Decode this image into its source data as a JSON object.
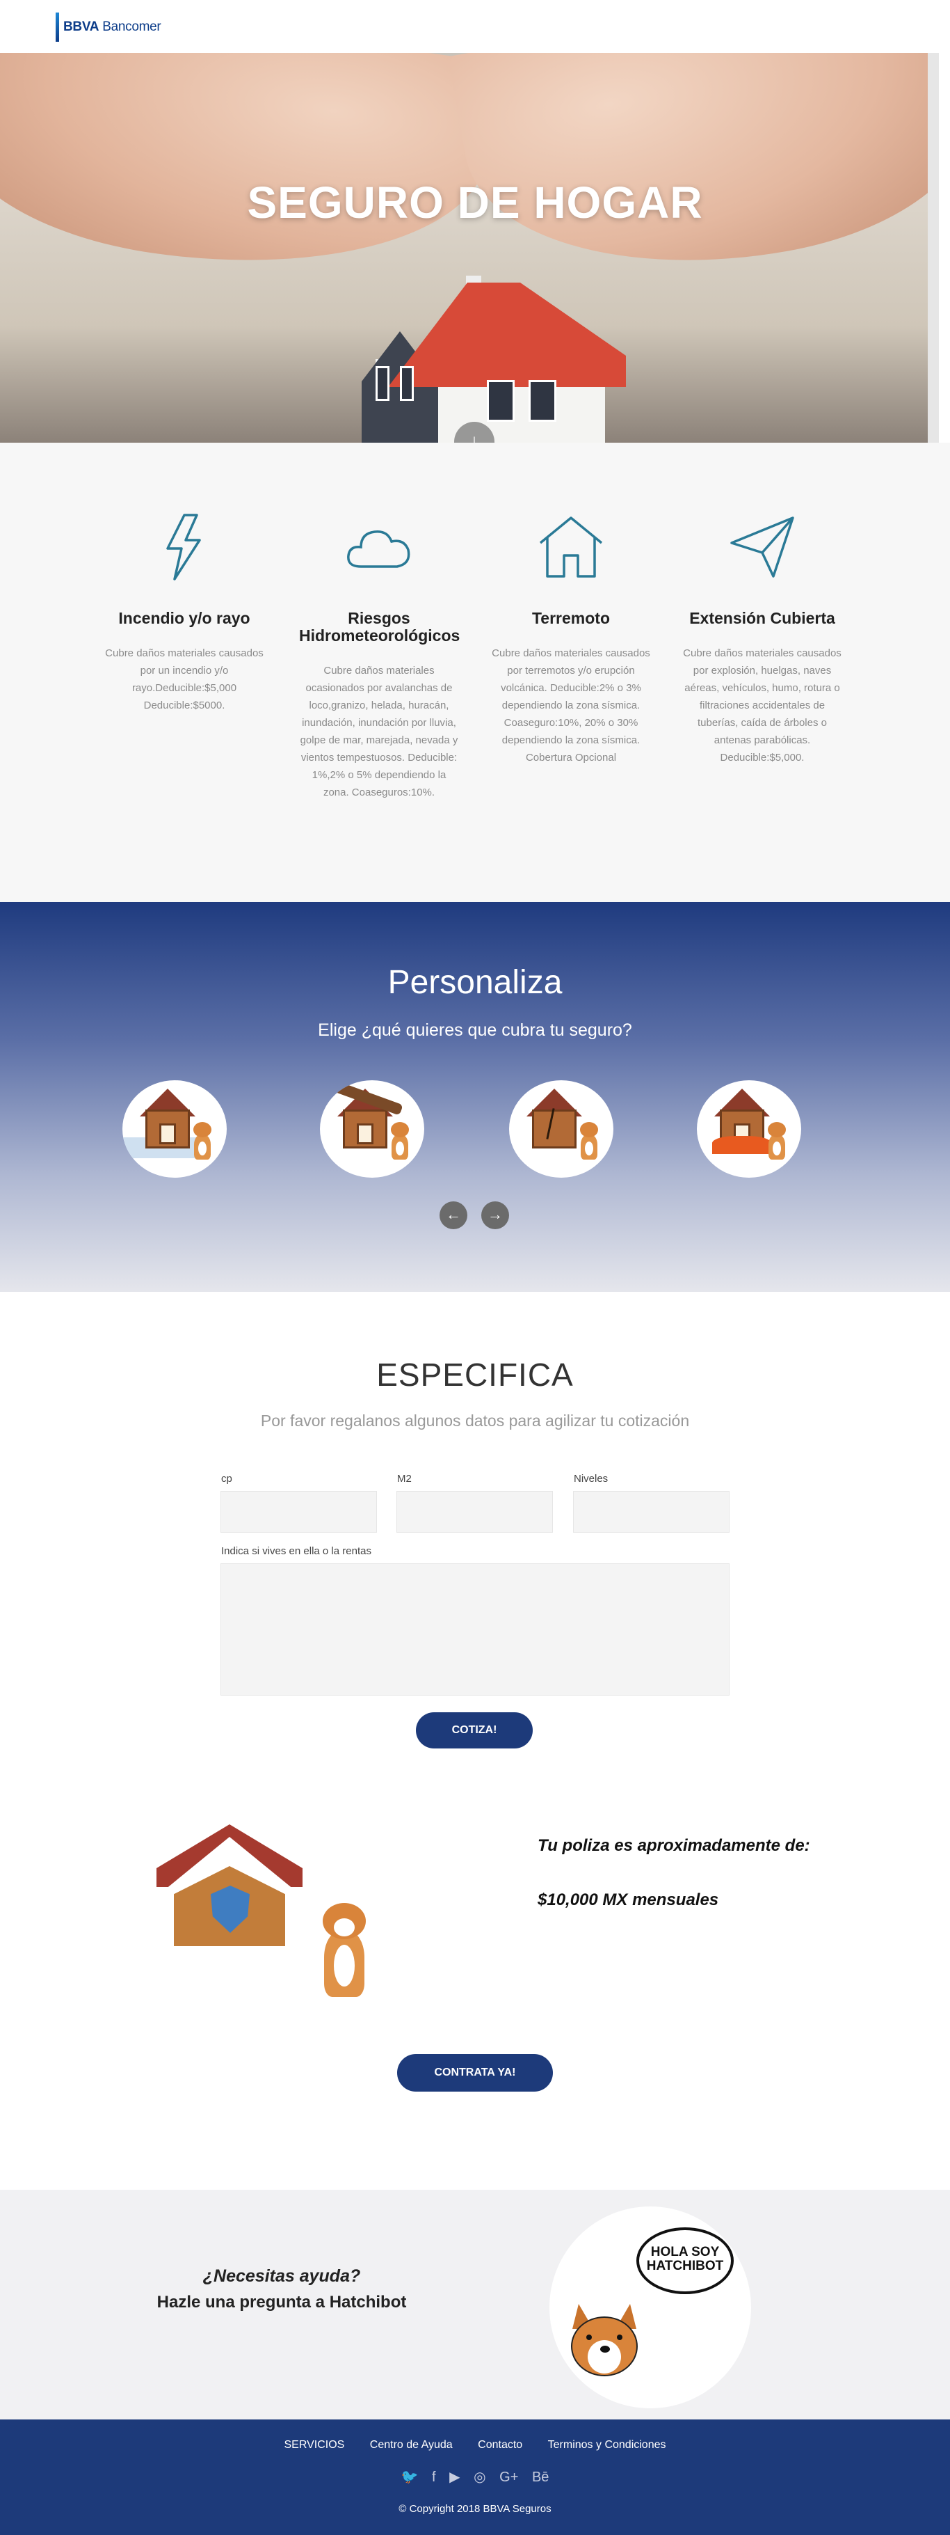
{
  "header": {
    "logo_bold": "BBVA",
    "logo_light": "Bancomer"
  },
  "hero": {
    "title": "SEGURO DE HOGAR",
    "scroll_glyph": "↓"
  },
  "features": [
    {
      "icon": "lightning-icon",
      "title": "Incendio y/o rayo",
      "desc": "Cubre daños materiales causados por un incendio y/o rayo.Deducible:$5,000 Deducible:$5000."
    },
    {
      "icon": "cloud-icon",
      "title": "Riesgos Hidrometeorológicos",
      "desc": "Cubre daños materiales ocasionados por avalanchas de loco,granizo, helada, huracán, inundación, inundación por lluvia, golpe de mar, marejada, nevada y vientos tempestuosos. Deducible: 1%,2% o 5% dependiendo la zona. Coaseguros:10%."
    },
    {
      "icon": "house-icon",
      "title": "Terremoto",
      "desc": "Cubre daños materiales causados por terremotos y/o erupción volcánica. Deducible:2% o 3% dependiendo la zona sísmica. Coaseguro:10%, 20% o 30% dependiendo la zona sísmica.",
      "extra": "Cobertura Opcional"
    },
    {
      "icon": "paper-plane-icon",
      "title": "Extensión Cubierta",
      "desc": "Cubre daños materiales causados por explosión, huelgas, naves aéreas, vehículos, humo, rotura o filtraciones accidentales de tuberías, caída de árboles o antenas parabólicas. Deducible:$5,000."
    }
  ],
  "personaliza": {
    "title": "Personaliza",
    "subtitle": "Elige ¿qué quieres que cubra tu seguro?",
    "prev_glyph": "←",
    "next_glyph": "→"
  },
  "especifica": {
    "title": "ESPECIFICA",
    "subtitle": "Por favor regalanos algunos datos para agilizar tu cotización",
    "labels": {
      "cp": "cp",
      "m2": "M2",
      "niveles": "Niveles",
      "renta": "Indica si vives en ella o la rentas"
    },
    "button": "COTIZA!"
  },
  "poliza": {
    "label": "Tu poliza es aproximadamente de:",
    "amount": "$10,000 MX mensuales",
    "button": "CONTRATA YA!"
  },
  "help": {
    "question": "¿Necesitas ayuda?",
    "ask": "Hazle una pregunta a Hatchibot",
    "bubble_line1": "HOLA SOY",
    "bubble_line2": "HATCHIBOT"
  },
  "footer": {
    "nav": [
      "SERVICIOS",
      "Centro de Ayuda",
      "Contacto",
      "Terminos y Condiciones"
    ],
    "social": [
      {
        "icon": "twitter-icon",
        "glyph": "🐦"
      },
      {
        "icon": "facebook-icon",
        "glyph": "f"
      },
      {
        "icon": "youtube-icon",
        "glyph": "▶"
      },
      {
        "icon": "instagram-icon",
        "glyph": "◎"
      },
      {
        "icon": "google-plus-icon",
        "glyph": "G+"
      },
      {
        "icon": "behance-icon",
        "glyph": "Bē"
      }
    ],
    "copyright": "© Copyright 2018 BBVA Seguros"
  },
  "colors": {
    "primary": "#1d3a7a",
    "icon_teal": "#2a7a96",
    "hero_title": "#ffffff"
  }
}
